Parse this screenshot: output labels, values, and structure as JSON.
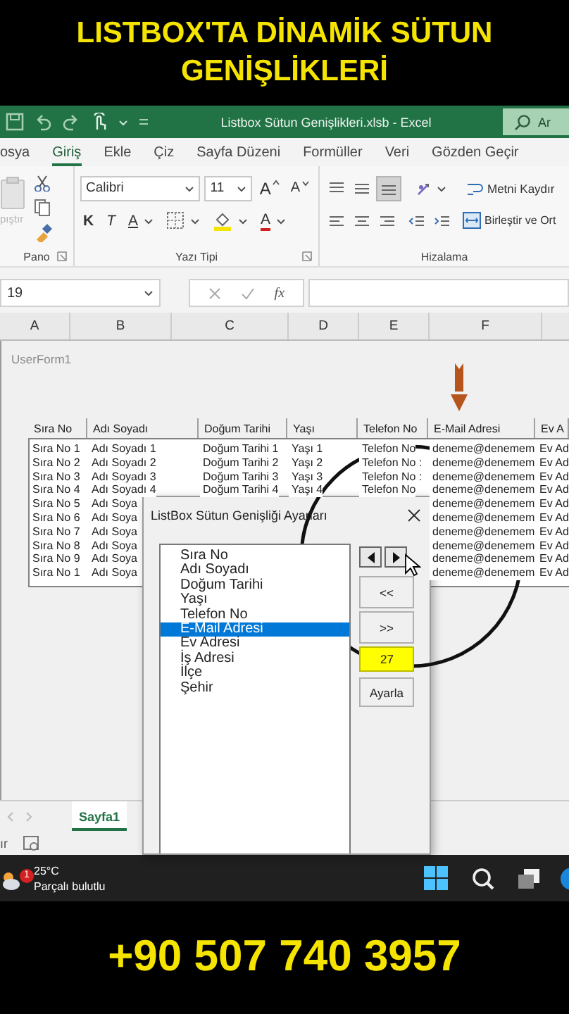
{
  "banner": {
    "title": "LISTBOX'TA DİNAMİK SÜTUN GENİŞLİKLERİ"
  },
  "excel_title_bar": {
    "title": "Listbox Sütun Genişlikleri.xlsb  -  Excel",
    "search": "Ar"
  },
  "ribbon_tabs": [
    {
      "label": "osya",
      "selected": false
    },
    {
      "label": "Giriş",
      "selected": true
    },
    {
      "label": "Ekle",
      "selected": false
    },
    {
      "label": "Çiz",
      "selected": false
    },
    {
      "label": "Sayfa Düzeni",
      "selected": false
    },
    {
      "label": "Formüller",
      "selected": false
    },
    {
      "label": "Veri",
      "selected": false
    },
    {
      "label": "Gözden Geçir",
      "selected": false
    }
  ],
  "ribbon": {
    "clipboard": {
      "paste_label": "pıştır",
      "group_label": "Pano"
    },
    "font": {
      "font_name": "Calibri",
      "font_size": "11",
      "grow": "A",
      "shrink": "A",
      "bold": "K",
      "italic": "T",
      "underline": "A",
      "font_color": "A",
      "group_label": "Yazı Tipi"
    },
    "alignment": {
      "vertical_alignment": [
        {
          "selected": false
        },
        {
          "selected": false
        },
        {
          "selected": true
        }
      ],
      "wrap_text": "Metni Kaydır",
      "merge": "Birleştir ve Ort",
      "group_label": "Hizalama"
    }
  },
  "formula_bar": {
    "name_box": "19",
    "function_button": "fx"
  },
  "column_headers": [
    "A",
    "B",
    "C",
    "D",
    "E",
    "F"
  ],
  "userform": {
    "title": "UserForm1",
    "listbox": {
      "columns": [
        "Sıra No",
        "Adı Soyadı",
        "Doğum Tarihi",
        "Yaşı",
        "Telefon No",
        "E-Mail Adresi",
        "Ev A"
      ],
      "rows": [
        {
          "cells": [
            "Sıra No 1",
            "Adı Soyadı 1",
            "Doğum Tarihi 1",
            "Yaşı 1",
            "Telefon No",
            "deneme@denemem",
            "Ev Ad"
          ]
        },
        {
          "cells": [
            "Sıra No 2",
            "Adı Soyadı 2",
            "Doğum Tarihi 2",
            "Yaşı 2",
            "Telefon No :",
            "deneme@denemem",
            "Ev Ad"
          ]
        },
        {
          "cells": [
            "Sıra No 3",
            "Adı Soyadı 3",
            "Doğum Tarihi 3",
            "Yaşı 3",
            "Telefon No :",
            "deneme@denemem",
            "Ev Ad"
          ]
        },
        {
          "cells": [
            "Sıra No 4",
            "Adı Soyadı 4",
            "Doğum Tarihi 4",
            "Yaşı 4",
            "Telefon No",
            "deneme@denemem",
            "Ev Ad"
          ]
        },
        {
          "cells": [
            "Sıra No 5",
            "Adı Soya",
            null,
            null,
            null,
            "deneme@denemem",
            "Ev Ad"
          ]
        },
        {
          "cells": [
            "Sıra No 6",
            "Adı Soya",
            null,
            null,
            null,
            "deneme@denemem",
            "Ev Ad"
          ]
        },
        {
          "cells": [
            "Sıra No 7",
            "Adı Soya",
            null,
            null,
            null,
            "deneme@denemem",
            "Ev Ad"
          ]
        },
        {
          "cells": [
            "Sıra No 8",
            "Adı Soya",
            null,
            null,
            null,
            "deneme@denemem",
            "Ev Ad"
          ]
        },
        {
          "cells": [
            "Sıra No 9",
            "Adı Soya",
            null,
            null,
            null,
            "deneme@denemem",
            "Ev Ad"
          ]
        },
        {
          "cells": [
            "Sıra No 1",
            "Adı Soya",
            null,
            null,
            null,
            "deneme@denemem",
            "Ev Ad"
          ]
        }
      ]
    }
  },
  "dialog": {
    "title": "ListBox Sütun Genişliği Ayarları",
    "columns": [
      {
        "label": "Sıra No",
        "selected": false
      },
      {
        "label": "Adı Soyadı",
        "selected": false
      },
      {
        "label": "Doğum Tarihi",
        "selected": false
      },
      {
        "label": "Yaşı",
        "selected": false
      },
      {
        "label": "Telefon No",
        "selected": false
      },
      {
        "label": "E-Mail Adresi",
        "selected": true
      },
      {
        "label": "Ev Adresi",
        "selected": false
      },
      {
        "label": "İş Adresi",
        "selected": false
      },
      {
        "label": "İlçe",
        "selected": false
      },
      {
        "label": "Şehir",
        "selected": false
      }
    ],
    "narrow_button": "<<",
    "widen_button": ">>",
    "width_value": "27",
    "apply_button": "Ayarla"
  },
  "sheet_tabs": [
    {
      "label": "Sayfa1",
      "selected": true
    }
  ],
  "status_bar": {
    "text": "ır"
  },
  "taskbar": {
    "badge": "1",
    "temperature": "25°C",
    "condition": "Parçalı bulutlu"
  },
  "footer": {
    "phone": "+90 507 740 3957"
  }
}
